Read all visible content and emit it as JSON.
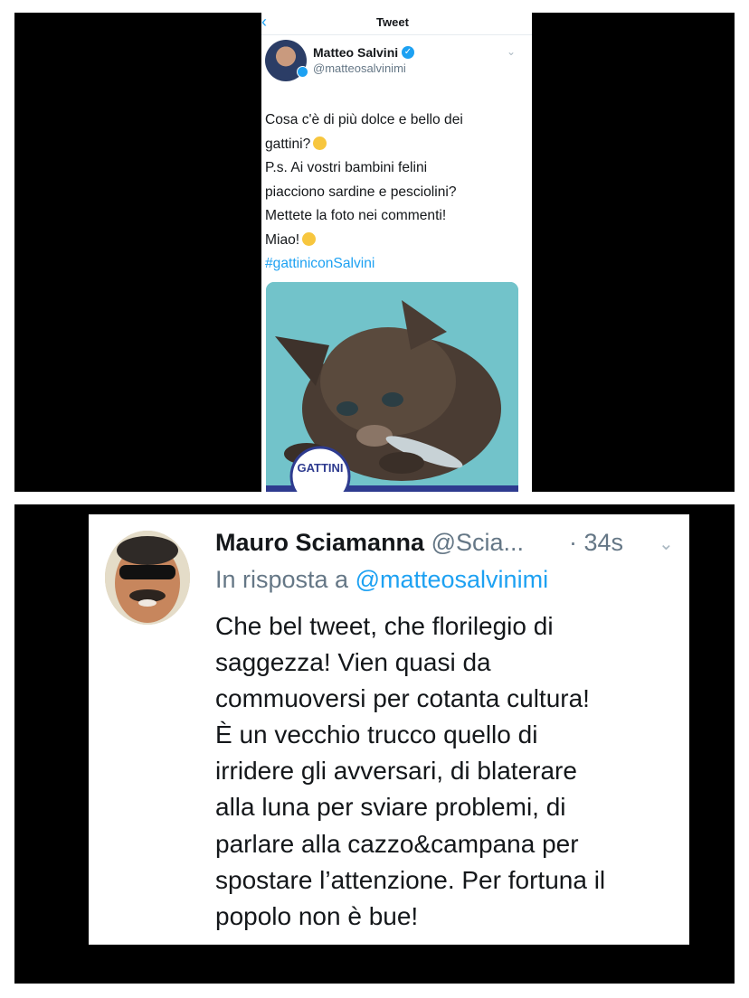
{
  "tweet": {
    "nav_title": "Tweet",
    "author_name": "Matteo Salvini",
    "author_handle": "@matteosalvinimi",
    "text_lines": [
      "Cosa c'è di più dolce e bello dei",
      "gattini?",
      "P.s. Ai vostri bambini felini",
      "piacciono sardine e pesciolini?",
      "Mettete la foto nei commenti!",
      "Miao!"
    ],
    "hashtag": "#gattiniconSalvini",
    "image_logo_text": "GATTINI"
  },
  "reply": {
    "author_name": "Mauro Sciamanna",
    "author_handle": "@Scia...",
    "time": "· 34s",
    "in_reply_prefix": "In risposta a",
    "in_reply_mention": "@matteosalvinimi",
    "text_lines": [
      "Che bel tweet, che florilegio di",
      "saggezza! Vien quasi da",
      "commuoversi per cotanta cultura!",
      "È un vecchio trucco quello di",
      "irridere gli avversari, di blaterare",
      "alla luna per sviare problemi, di",
      "parlare alla cazzo&campana per",
      "spostare l’attenzione. Per fortuna il",
      "popolo non è bue!"
    ]
  },
  "colors": {
    "accent": "#1da1f2",
    "text": "#14171a",
    "secondary": "#657786"
  }
}
